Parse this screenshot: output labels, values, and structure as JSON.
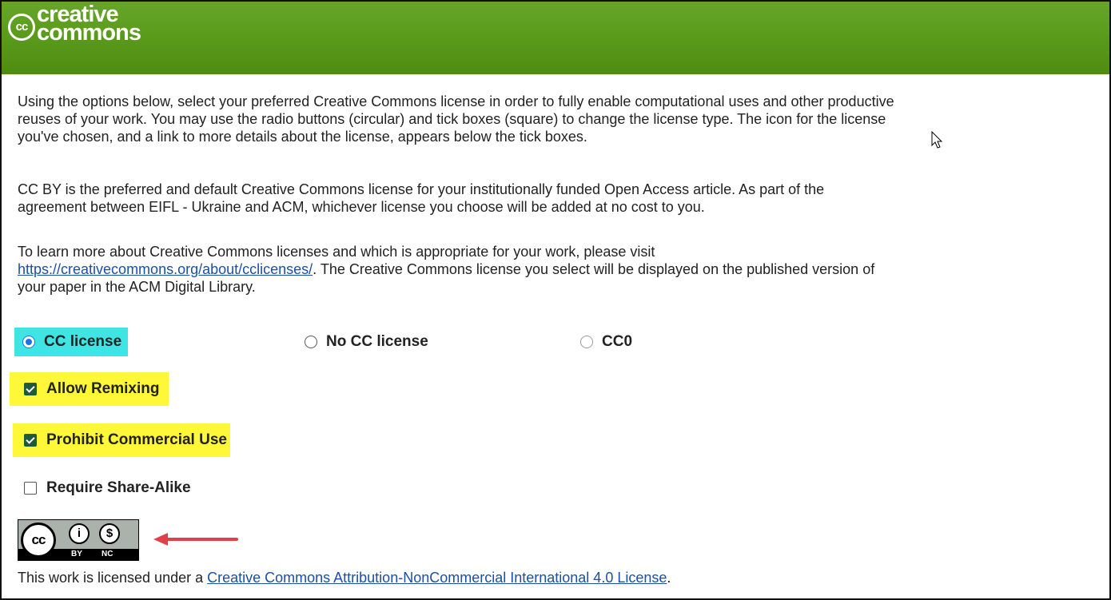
{
  "header": {
    "logo_cc": "cc",
    "logo_line1": "creative",
    "logo_line2": "commons",
    "bg_color": "#5c9d1d"
  },
  "intro": {
    "line1": "Using the options below, select your preferred Creative Commons license in order to fully enable computational uses and other productive",
    "line2": "reuses of your work. You may use the radio buttons (circular) and tick boxes (square) to change the license type. The icon for the license",
    "line3": "you've chosen, and a link to more details about the license, appears below the tick boxes."
  },
  "preferred": {
    "line1": "CC BY is the preferred and default Creative Commons license for your institutionally funded Open Access article. As part of the",
    "line2": "agreement between EIFL - Ukraine and ACM, whichever license you choose will be added at no cost to you."
  },
  "learn_more": {
    "line1": "To learn more about Creative Commons licenses and which is appropriate for your work, please visit",
    "link": "https://creativecommons.org/about/cclicenses/",
    "line2_rest": ". The Creative Commons license you select will be displayed on the published version of",
    "line3": "your paper in the ACM Digital Library."
  },
  "license_options": [
    {
      "label": "CC license",
      "selected": true
    },
    {
      "label": "No CC license",
      "selected": false
    },
    {
      "label": "CC0",
      "selected": false
    }
  ],
  "checkboxes": [
    {
      "label": "Allow Remixing",
      "checked": true
    },
    {
      "label": "Prohibit Commercial Use",
      "checked": true
    },
    {
      "label": "Require Share-Alike",
      "checked": false
    }
  ],
  "badge": {
    "cc_text": "cc",
    "by_label": "BY",
    "nc_label": "NC",
    "by_symbol": "i",
    "nc_symbol": "$"
  },
  "footer": {
    "prefix": "This work is licensed under a ",
    "link": "Creative Commons Attribution-NonCommercial International 4.0 License",
    "suffix": "."
  },
  "colors": {
    "radio_highlight": "#3fe4e4",
    "checkbox_highlight": "#fff839",
    "arrow": "#e0404a",
    "link": "#1a4faa"
  }
}
